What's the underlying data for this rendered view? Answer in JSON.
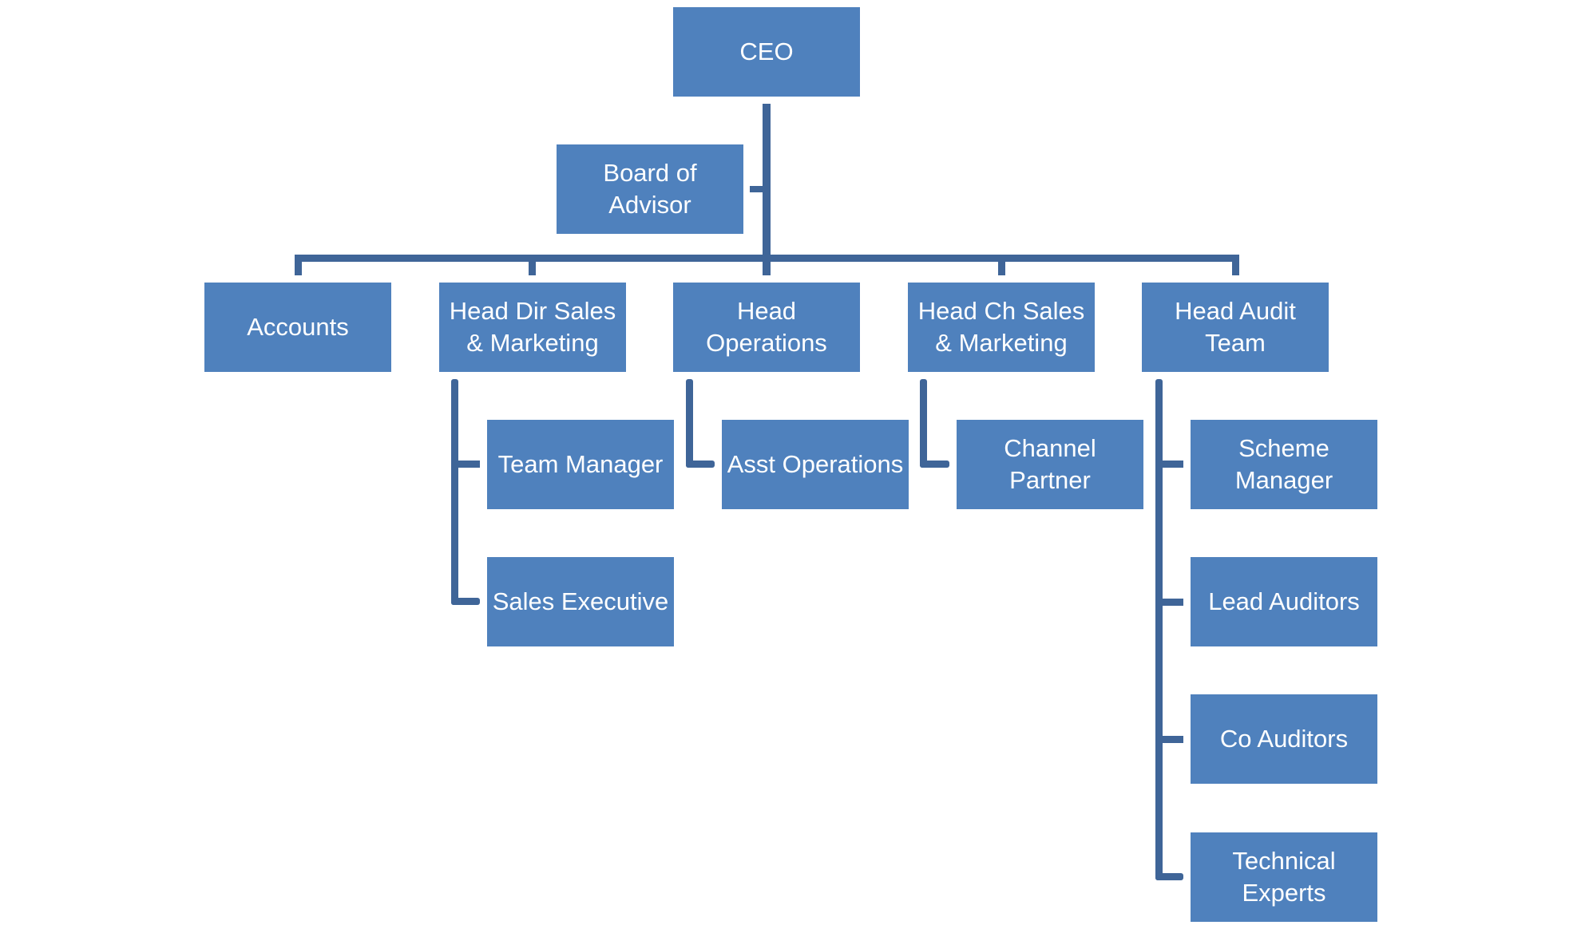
{
  "colors": {
    "node_fill": "#4F81BD",
    "connector": "#3F6598",
    "text": "#FFFFFF",
    "background": "#FFFFFF"
  },
  "org_chart": {
    "root": "CEO",
    "assistant": "Board of\nAdvisor",
    "departments": [
      {
        "label": "Accounts",
        "children": []
      },
      {
        "label": "Head Dir Sales\n& Marketing",
        "children": [
          "Team Manager",
          "Sales Executive"
        ]
      },
      {
        "label": "Head\nOperations",
        "children": [
          "Asst Operations"
        ]
      },
      {
        "label": "Head Ch Sales\n& Marketing",
        "children": [
          "Channel\nPartner"
        ]
      },
      {
        "label": "Head Audit\nTeam",
        "children": [
          "Scheme\nManager",
          "Lead Auditors",
          "Co Auditors",
          "Technical\nExperts"
        ]
      }
    ]
  }
}
